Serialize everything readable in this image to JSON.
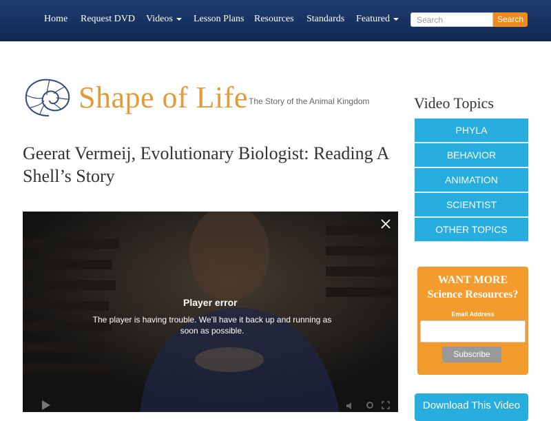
{
  "nav": {
    "home": "Home",
    "request_dvd": "Request DVD",
    "videos": "Videos",
    "lesson_plans": "Lesson Plans",
    "resources": "Resources",
    "standards": "Standards",
    "featured": "Featured"
  },
  "search": {
    "placeholder": "Search",
    "button_label": "Search"
  },
  "logo": {
    "name": "Shape of Life",
    "tagline": "The Story of the Animal Kingdom"
  },
  "article": {
    "title": "Geerat Vermeij, Evolutionary Biologist: Reading A Shell’s Story"
  },
  "video": {
    "error_title": "Player error",
    "error_message": "The player is having trouble. We’ll have it back up and running as soon as possible.",
    "icons": [
      "close-icon",
      "play-icon",
      "volume-icon",
      "settings-icon",
      "fullscreen-icon"
    ]
  },
  "sidebar": {
    "heading": "Video Topics",
    "topics": [
      "PHYLA",
      "BEHAVIOR",
      "ANIMATION",
      "SCIENTIST",
      "OTHER TOPICS"
    ],
    "promo": {
      "line1": "WANT MORE",
      "line2": "Science Resources?",
      "email_label": "Email Address",
      "subscribe_label": "Subscribe"
    },
    "download_label": "Download This Video"
  },
  "colors": {
    "nav_background": "#1a3a6e",
    "accent_orange": "#f08a1c",
    "topic_blue": "#27aede",
    "promo_orange": "#f39b2c",
    "logo_orange": "#e39a3a"
  }
}
